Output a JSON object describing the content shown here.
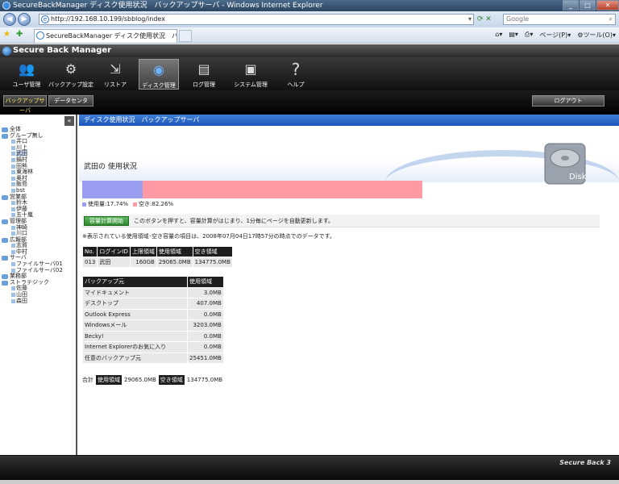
{
  "window": {
    "title": "SecureBackManager ディスク使用状況　バックアップサーバ - Windows Internet Explorer"
  },
  "browser": {
    "url": "http://192.168.10.199/sbblog/index",
    "search_placeholder": "Google",
    "tab_title": "SecureBackManager ディスク使用状況　バッ...",
    "page_menu": "ページ(P)",
    "tools_menu": "ツール(O)"
  },
  "app": {
    "title": "Secure Back Manager",
    "brand_footer": "Secure Back 3"
  },
  "toolmenu": [
    {
      "label": "ユーザ管理",
      "icon": "users-icon"
    },
    {
      "label": "バックアップ設定",
      "icon": "backup-settings-icon"
    },
    {
      "label": "リストア",
      "icon": "restore-icon"
    },
    {
      "label": "ディスク管理",
      "icon": "disk-icon"
    },
    {
      "label": "ログ管理",
      "icon": "log-icon"
    },
    {
      "label": "システム管理",
      "icon": "system-icon"
    },
    {
      "label": "ヘルプ",
      "icon": "help-icon"
    }
  ],
  "subnav": {
    "backup_server": "バックアップサーバ",
    "data_center": "データセンタ",
    "logout": "ログアウト"
  },
  "tree": [
    {
      "label": "全体",
      "type": "group"
    },
    {
      "label": "グループ無し",
      "type": "group"
    },
    {
      "label": "井口",
      "type": "leaf"
    },
    {
      "label": "川上",
      "type": "leaf"
    },
    {
      "label": "武田",
      "type": "leaf",
      "selected": true
    },
    {
      "label": "鍋村",
      "type": "leaf"
    },
    {
      "label": "田熊",
      "type": "leaf"
    },
    {
      "label": "東海林",
      "type": "leaf"
    },
    {
      "label": "奥村",
      "type": "leaf"
    },
    {
      "label": "飯島",
      "type": "leaf"
    },
    {
      "label": "bst",
      "type": "leaf"
    },
    {
      "label": "営業部",
      "type": "group"
    },
    {
      "label": "鈴木",
      "type": "leaf"
    },
    {
      "label": "伊藤",
      "type": "leaf"
    },
    {
      "label": "五十嵐",
      "type": "leaf"
    },
    {
      "label": "管理部",
      "type": "group"
    },
    {
      "label": "神崎",
      "type": "leaf"
    },
    {
      "label": "川口",
      "type": "leaf"
    },
    {
      "label": "広報部",
      "type": "group"
    },
    {
      "label": "志賀",
      "type": "leaf"
    },
    {
      "label": "中村",
      "type": "leaf"
    },
    {
      "label": "サーバ",
      "type": "group"
    },
    {
      "label": "ファイルサーバ01",
      "type": "leaf"
    },
    {
      "label": "ファイルサーバ02",
      "type": "leaf"
    },
    {
      "label": "業務部",
      "type": "group"
    },
    {
      "label": "ストラテジック",
      "type": "group"
    },
    {
      "label": "佐藤",
      "type": "leaf"
    },
    {
      "label": "山田",
      "type": "leaf"
    },
    {
      "label": "森田",
      "type": "leaf"
    }
  ],
  "page": {
    "bar_title": "ディスク使用状況　バックアップサーバ",
    "heading": "武田の 使用状況",
    "disk_label": "Disk",
    "used_percent": 17.74,
    "used_label": "使用量:17.74%",
    "free_label": "空き:82.26%",
    "used_color": "#9a9ef0",
    "free_color": "#ff9aa4",
    "calc_button": "容量計算開始",
    "calc_message": "このボタンを押すと、容量計算がはじまり、1分毎にページを自動更新します。",
    "note": "※表示されている使用領域･空き容量の項目は、2008年07月04日17時57分の時点でのデータです。"
  },
  "user_table": {
    "headers": [
      "No.",
      "ログインID",
      "上限領域",
      "使用領域",
      "空き領域"
    ],
    "row": [
      "013",
      "武田",
      "160GB",
      "29065.0MB",
      "134775.0MB"
    ]
  },
  "backup_table": {
    "headers": [
      "バックアップ元",
      "使用領域"
    ],
    "rows": [
      [
        "マイドキュメント",
        "3.0MB"
      ],
      [
        "デスクトップ",
        "407.0MB"
      ],
      [
        "Outlook Express",
        "0.0MB"
      ],
      [
        "Windowsメール",
        "3203.0MB"
      ],
      [
        "Becky!",
        "0.0MB"
      ],
      [
        "Internet Explorerのお気に入り",
        "0.0MB"
      ],
      [
        "任意のバックアップ元",
        "25451.0MB"
      ]
    ]
  },
  "totals": {
    "label": "合計",
    "used_label": "使用領域",
    "used_value": "29065.0MB",
    "free_label": "空き領域",
    "free_value": "134775.0MB"
  }
}
